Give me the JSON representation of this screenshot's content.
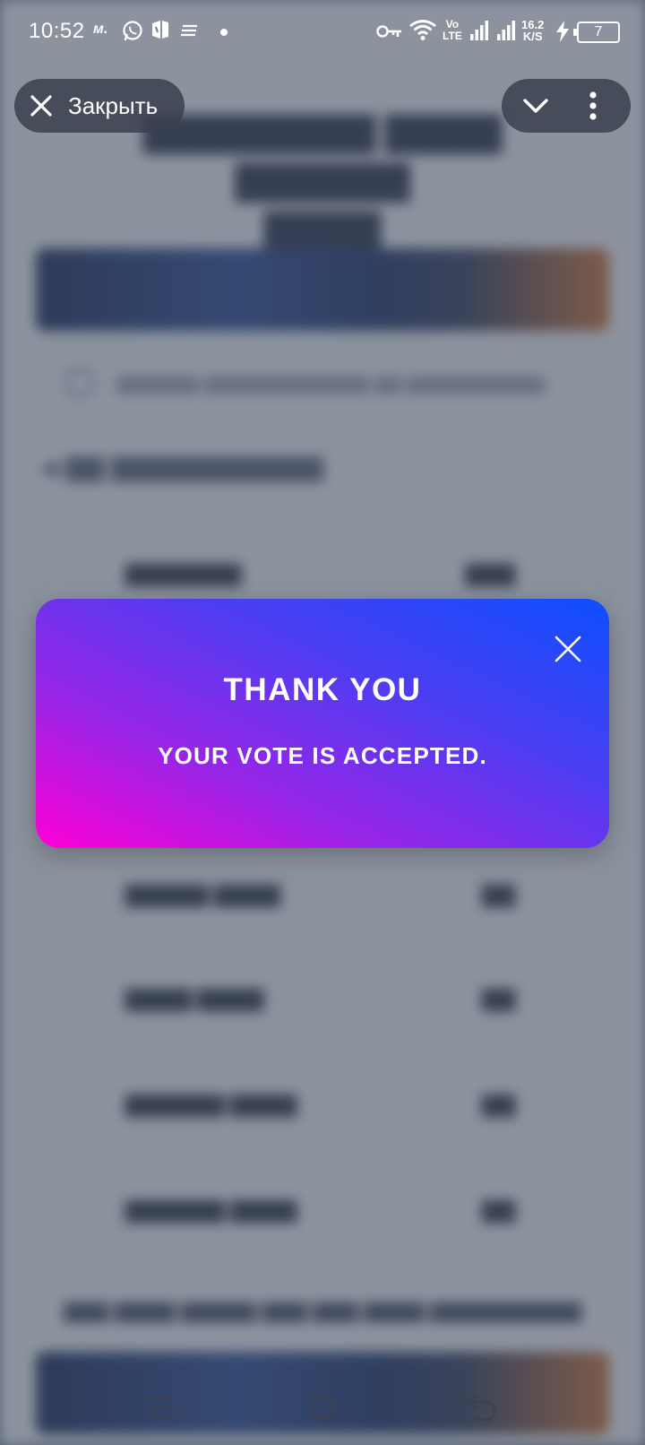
{
  "status_bar": {
    "time": "10:52",
    "m_badge": "м.",
    "volte_top": "Vo",
    "volte_bottom": "LTE",
    "speed_value": "16.2",
    "speed_unit": "K/S",
    "battery": "7"
  },
  "top_bar": {
    "close_label": "Закрыть"
  },
  "modal": {
    "title": "THANK YOU",
    "message": "YOUR VOTE IS ACCEPTED.",
    "gradient_start": "#ff00d6",
    "gradient_end": "#0d4fff"
  },
  "colors": {
    "scrim": "#465064",
    "pill_background": "#3a404e"
  }
}
